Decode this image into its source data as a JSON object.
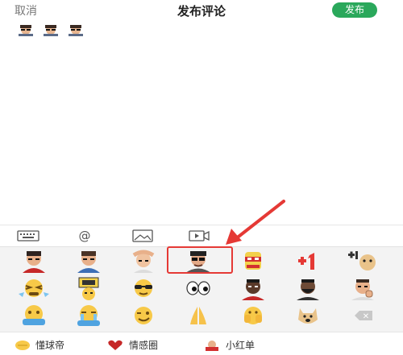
{
  "header": {
    "cancel_label": "取消",
    "title": "发布评论",
    "publish_label": "发布"
  },
  "comment": {
    "inserted_stickers": [
      "sticker",
      "sticker",
      "sticker"
    ]
  },
  "toolbar": {
    "icons": [
      "keyboard-icon",
      "mention-icon",
      "image-icon",
      "video-icon"
    ],
    "mention_symbol": "@"
  },
  "emoji_panel": {
    "rows": [
      [
        "man-red-shirt-sticker",
        "man-blue-shirt-sticker",
        "man-headache-sticker",
        "man-sunglasses-sticker",
        "ninja-sticker",
        "plus-one-sticker",
        "plus-one-dog-sticker"
      ],
      [
        "rich-face-sticker",
        "sign-face-sticker",
        "sunglasses-face-sticker",
        "eyes-sticker",
        "player-dark-sticker",
        "player-beard-sticker",
        "man-thinking-sticker"
      ],
      [
        "nhvl-face-sticker",
        "crying-face-sticker",
        "wink-face-sticker",
        "pray-hands-sticker",
        "covering-face-sticker",
        "doge-sticker",
        "delete-key"
      ]
    ],
    "highlighted": "man-sunglasses-sticker",
    "highlight_color": "#e53935",
    "delete_symbol": "✕"
  },
  "packs": [
    {
      "label": "懂球帝",
      "icon": "ball-icon"
    },
    {
      "label": "情感圈",
      "icon": "heart-icon"
    },
    {
      "label": "小红单",
      "icon": "red-card-icon"
    }
  ],
  "colors": {
    "publish": "#2aa85b",
    "accent_red": "#e53935"
  }
}
